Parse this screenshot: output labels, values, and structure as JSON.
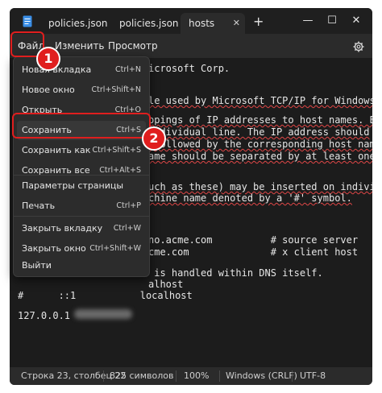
{
  "tabs": [
    {
      "label": "policies.json"
    },
    {
      "label": "policies.json"
    },
    {
      "label": "hosts"
    }
  ],
  "new_tab": "+",
  "close_tab": "✕",
  "window_controls": {
    "minimize": "—",
    "maximize": "☐",
    "close": "✕"
  },
  "menubar": {
    "file": "Файл",
    "edit": "Изменить",
    "view": "Просмотр"
  },
  "file_menu": [
    {
      "label": "Новая вкладка",
      "shortcut": "Ctrl+N"
    },
    {
      "label": "Новое окно",
      "shortcut": "Ctrl+Shift+N"
    },
    {
      "label": "Открыть",
      "shortcut": "Ctrl+O"
    },
    {
      "label": "Сохранить",
      "shortcut": "Ctrl+S"
    },
    {
      "label": "Сохранить как",
      "shortcut": "Ctrl+Shift+S"
    },
    {
      "label": "Сохранить все",
      "shortcut": "Ctrl+Alt+S"
    },
    {
      "label": "Параметры страницы",
      "shortcut": ""
    },
    {
      "label": "Печать",
      "shortcut": "Ctrl+P"
    },
    {
      "label": "Закрыть вкладку",
      "shortcut": "Ctrl+W"
    },
    {
      "label": "Закрыть окно",
      "shortcut": "Ctrl+Shift+W"
    },
    {
      "label": "Выйти",
      "shortcut": ""
    }
  ],
  "editor_lines": [
    "icrosoft Corp.",
    "le used by Microsoft TCP/IP for Windows.",
    "ppings of IP addresses to host names. Each",
    "individual line. The IP address should",
    " followed by the corresponding host name.",
    "ame should be separated by at least one",
    "uch as these) may be inserted on individual",
    "chine name denoted by a '#' symbol.",
    "no.acme.com          # source server",
    "cme.com              # x client host",
    " is handled within DNS itself.",
    "alhost",
    "#      ::1           localhost",
    "127.0.0.1"
  ],
  "status": {
    "position": "Строка 23, столбец 22",
    "chars": "825 символов",
    "zoom": "100%",
    "eol": "Windows (CRLF)",
    "encoding": "UTF-8"
  },
  "annotations": {
    "step1": "1",
    "step2": "2"
  },
  "colors": {
    "highlight": "#e01e1e",
    "background": "#1c1c1c",
    "menubar": "#2b2b2b"
  }
}
